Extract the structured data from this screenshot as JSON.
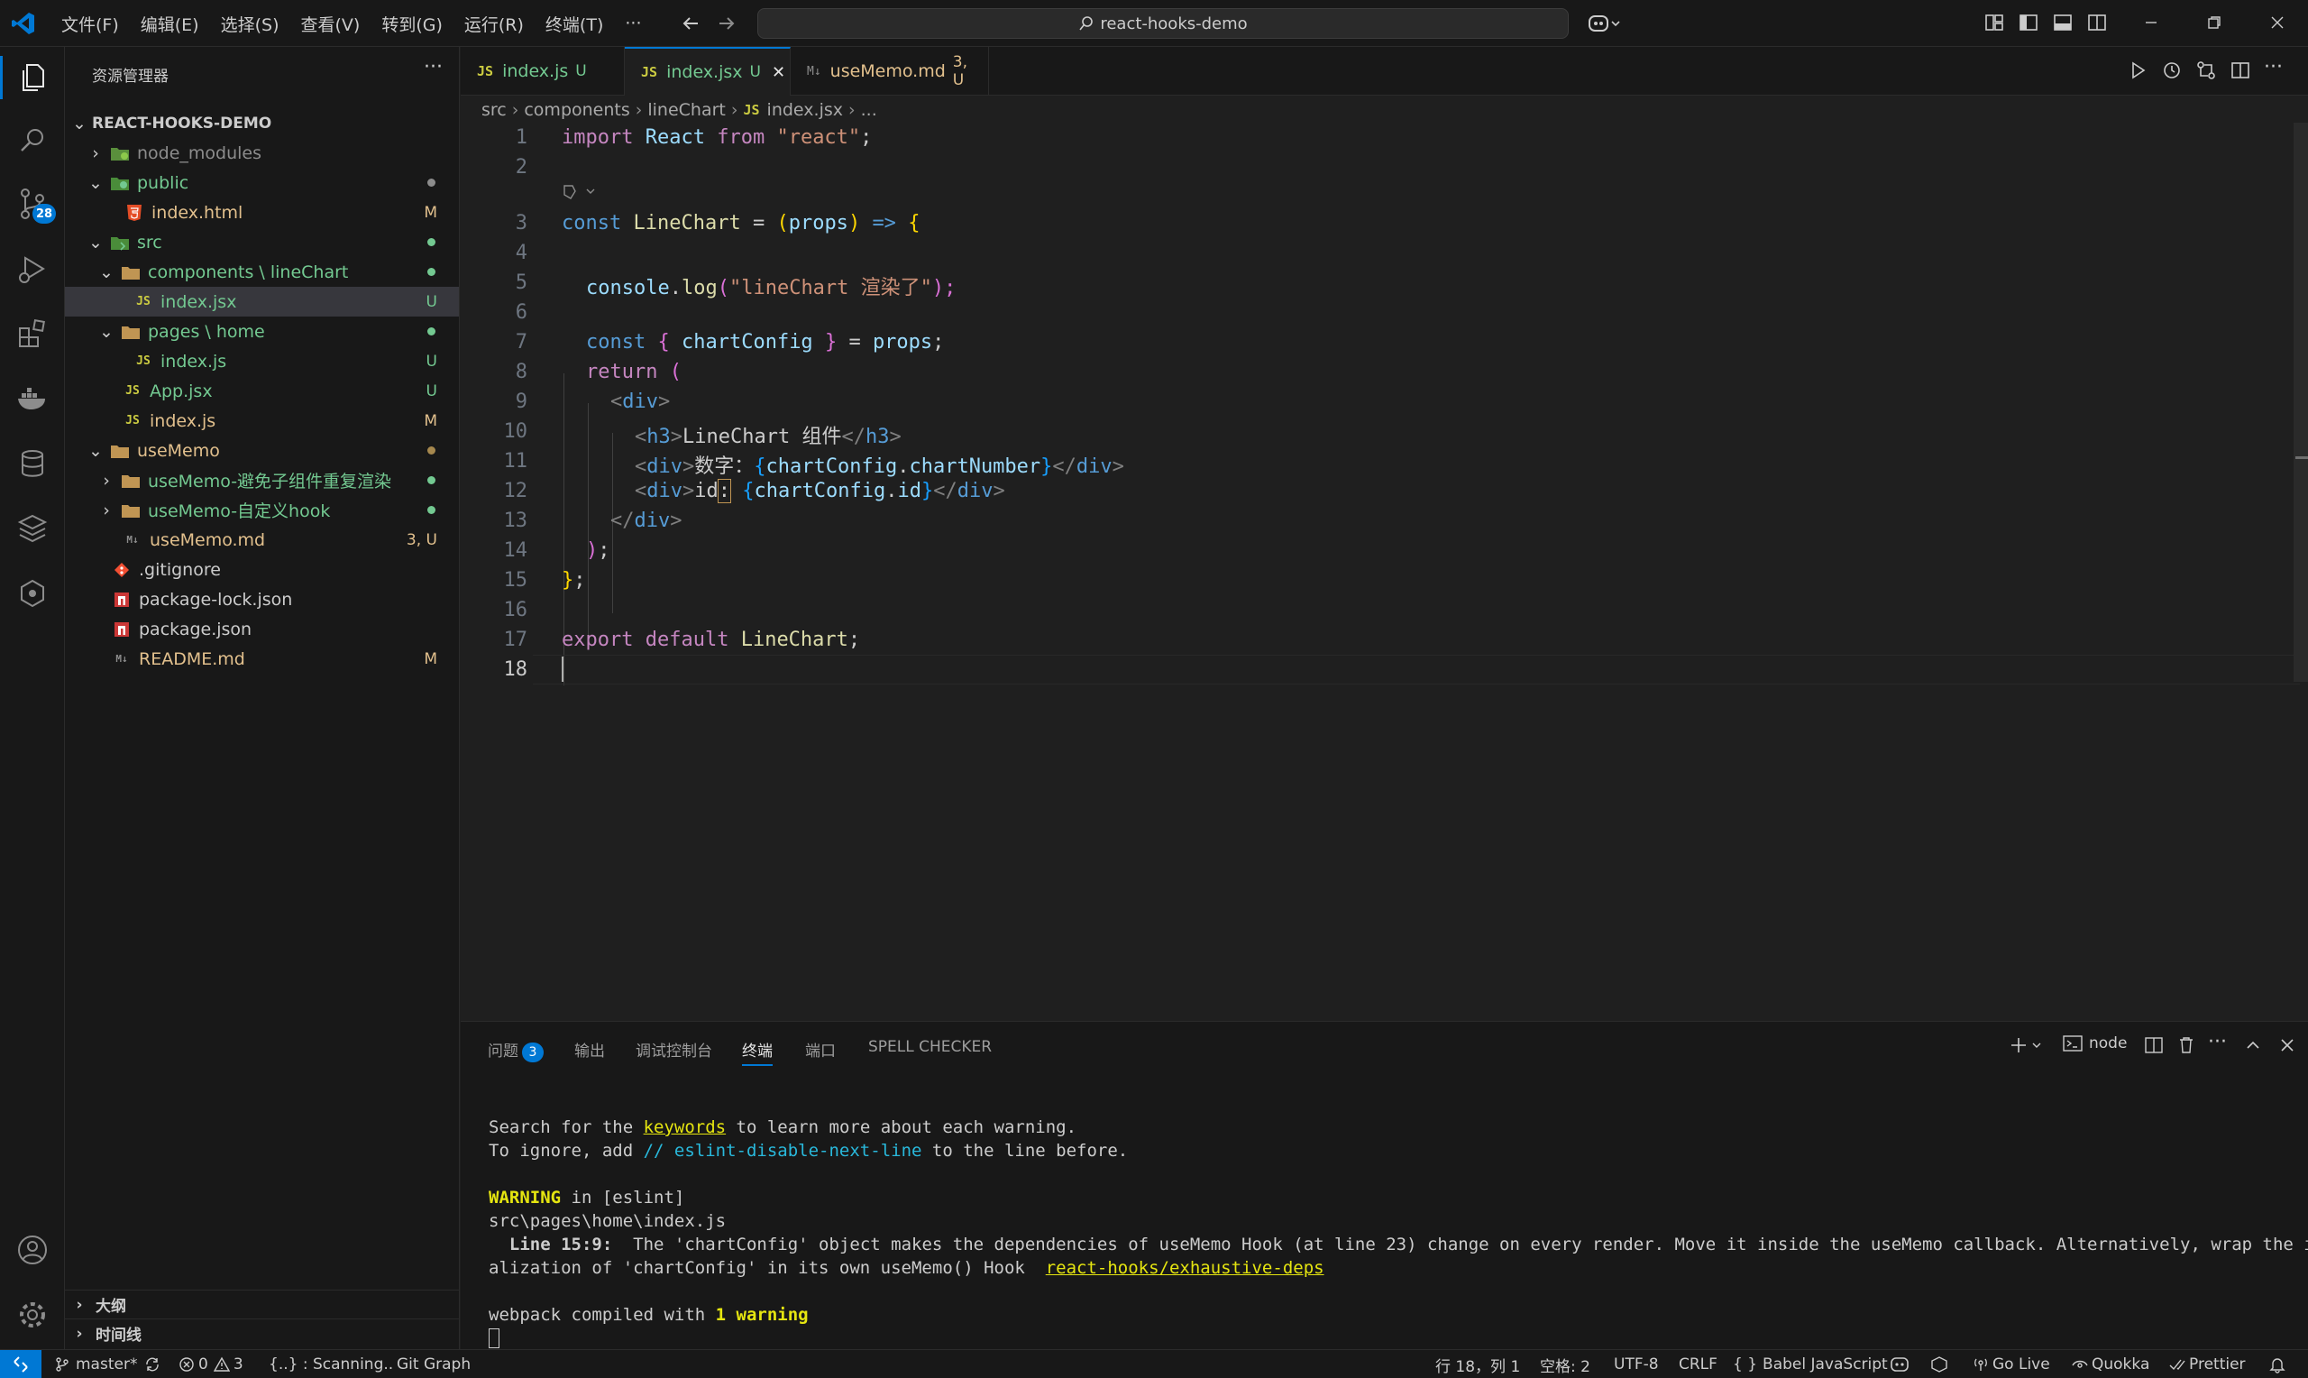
{
  "titlebar": {
    "menu": [
      "文件(F)",
      "编辑(E)",
      "选择(S)",
      "查看(V)",
      "转到(G)",
      "运行(R)",
      "终端(T)",
      "···"
    ],
    "search": "react-hooks-demo"
  },
  "activitybar": {
    "scm_badge": "28"
  },
  "explorer": {
    "header": "资源管理器",
    "more": "···",
    "root": "REACT-HOOKS-DEMO",
    "items": [
      {
        "label": "node_modules",
        "status": ""
      },
      {
        "label": "public",
        "status": ""
      },
      {
        "label": "index.html",
        "status": "M"
      },
      {
        "label": "src",
        "status": ""
      },
      {
        "label": "components \\ lineChart",
        "status": ""
      },
      {
        "label": "index.jsx",
        "status": "U"
      },
      {
        "label": "pages \\ home",
        "status": ""
      },
      {
        "label": "index.js",
        "status": "U"
      },
      {
        "label": "App.jsx",
        "status": "U"
      },
      {
        "label": "index.js",
        "status": "M"
      },
      {
        "label": "useMemo",
        "status": ""
      },
      {
        "label": "useMemo-避免子组件重复渲染",
        "status": ""
      },
      {
        "label": "useMemo-自定义hook",
        "status": ""
      },
      {
        "label": "useMemo.md",
        "status": "3, U"
      },
      {
        "label": ".gitignore",
        "status": ""
      },
      {
        "label": "package-lock.json",
        "status": ""
      },
      {
        "label": "package.json",
        "status": ""
      },
      {
        "label": "README.md",
        "status": "M"
      }
    ],
    "icon_labels": {
      "js": "JS",
      "md": "M↓"
    },
    "outline": "大纲",
    "timeline": "时间线"
  },
  "tabs": [
    {
      "label": "index.js",
      "status": "U",
      "icon": "JS"
    },
    {
      "label": "index.jsx",
      "status": "U",
      "icon": "JS",
      "close": "✕"
    },
    {
      "label": "useMemo.md",
      "status": "3, U",
      "icon": "M↓"
    }
  ],
  "breadcrumb": [
    "src",
    "components",
    "lineChart",
    "index.jsx",
    "..."
  ],
  "editor": {
    "line_numbers": [
      "1",
      "2",
      "3",
      "4",
      "5",
      "6",
      "7",
      "8",
      "9",
      "10",
      "11",
      "12",
      "13",
      "14",
      "15",
      "16",
      "17",
      "18"
    ],
    "code": {
      "l1": [
        "import",
        "React",
        "from",
        "\"react\"",
        ";"
      ],
      "l3": [
        "const",
        "LineChart",
        "=",
        "(",
        "props",
        ")",
        "=>",
        "{"
      ],
      "l5": [
        "console",
        ".",
        "log",
        "(",
        "\"lineChart 渲染了\"",
        ");"
      ],
      "l7": [
        "const",
        "{",
        "chartConfig",
        "}",
        "=",
        "props",
        ";"
      ],
      "l8": [
        "return",
        "("
      ],
      "l9": [
        "<",
        "div",
        ">"
      ],
      "l10": [
        "<",
        "h3",
        ">",
        "LineChart 组件",
        "</",
        "h3",
        ">"
      ],
      "l11": [
        "<",
        "div",
        ">",
        "数字：",
        "{",
        "chartConfig",
        ".",
        "chartNumber",
        "}",
        "</",
        "div",
        ">"
      ],
      "l12": [
        "<",
        "div",
        ">",
        "id",
        ":",
        " ",
        "{",
        "chartConfig",
        ".",
        "id",
        "}",
        "</",
        "div",
        ">"
      ],
      "l13": [
        "</",
        "div",
        ">"
      ],
      "l14": [
        ")",
        ";"
      ],
      "l15": [
        "}",
        ";"
      ],
      "l17": [
        "export",
        "default",
        "LineChart",
        ";"
      ]
    }
  },
  "panel": {
    "tabs": [
      "问题",
      "输出",
      "调试控制台",
      "终端",
      "端口",
      "SPELL CHECKER"
    ],
    "problems_badge": "3",
    "shell": "node",
    "terminal": {
      "l1a": "Search for the ",
      "l1b": "keywords",
      "l1c": " to learn more about each warning.",
      "l2a": "To ignore, add ",
      "l2b": "// eslint-disable-next-line",
      "l2c": " to the line before.",
      "l3a": "WARNING",
      "l3b": " in [eslint]",
      "l4": "src\\pages\\home\\index.js",
      "l5a": "  Line 15:9:",
      "l5b": "  The 'chartConfig' object makes the dependencies of useMemo Hook (at line 23) change on every render. Move it inside the useMemo callback. Alternatively, wrap the initi",
      "l6a": "alization of 'chartConfig' in its own useMemo() Hook  ",
      "l6b": "react-hooks/exhaustive-deps",
      "l7a": "webpack compiled with ",
      "l7b": "1 warning"
    }
  },
  "statusbar": {
    "branch": "master*",
    "errors": "0",
    "warnings": "3",
    "scanning": "{..} : Scanning..",
    "git_graph": "Git Graph",
    "position": "行 18，列 1",
    "spaces": "空格: 2",
    "encoding": "UTF-8",
    "eol": "CRLF",
    "language": "Babel JavaScript",
    "golive": "Go Live",
    "quokka": "Quokka",
    "prettier": "Prettier"
  },
  "colors": {
    "accent": "#0078d4",
    "untracked": "#73c991",
    "modified": "#e2c08d"
  }
}
